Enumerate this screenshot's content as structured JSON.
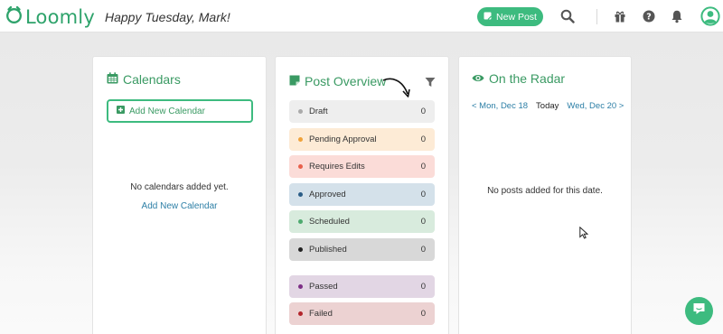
{
  "header": {
    "logo_text": "Loomly",
    "greeting": "Happy Tuesday, Mark!",
    "new_post_label": "New Post",
    "icons": [
      "search-icon",
      "gift-icon",
      "help-icon",
      "bell-icon",
      "user-icon"
    ]
  },
  "colors": {
    "brand_green": "#3dbb7f",
    "title_green": "#3a9a63",
    "link_blue": "#2d7fa6"
  },
  "calendars": {
    "title": "Calendars",
    "add_button": "Add New Calendar",
    "empty_text": "No calendars added yet.",
    "add_link": "Add New Calendar"
  },
  "post_overview": {
    "title": "Post Overview",
    "statuses": [
      {
        "label": "Draft",
        "count": "0",
        "dot": "#aaaaaa",
        "bg": "#eeeeee"
      },
      {
        "label": "Pending Approval",
        "count": "0",
        "dot": "#f0a23a",
        "bg": "#fdebd6"
      },
      {
        "label": "Requires Edits",
        "count": "0",
        "dot": "#e8604c",
        "bg": "#fbdcd8"
      },
      {
        "label": "Approved",
        "count": "0",
        "dot": "#2a5d87",
        "bg": "#d4e1ea"
      },
      {
        "label": "Scheduled",
        "count": "0",
        "dot": "#4daa6e",
        "bg": "#d8ebdd"
      },
      {
        "label": "Published",
        "count": "0",
        "dot": "#222222",
        "bg": "#d8d8d8"
      },
      {
        "label": "Passed",
        "count": "0",
        "dot": "#7d2f86",
        "bg": "#e2d6e4"
      },
      {
        "label": "Failed",
        "count": "0",
        "dot": "#b3262c",
        "bg": "#ecd2d2"
      }
    ]
  },
  "radar": {
    "title": "On the Radar",
    "prev_date": "< Mon, Dec 18",
    "today": "Today",
    "next_date": "Wed, Dec 20 >",
    "empty_text": "No posts added for this date."
  }
}
